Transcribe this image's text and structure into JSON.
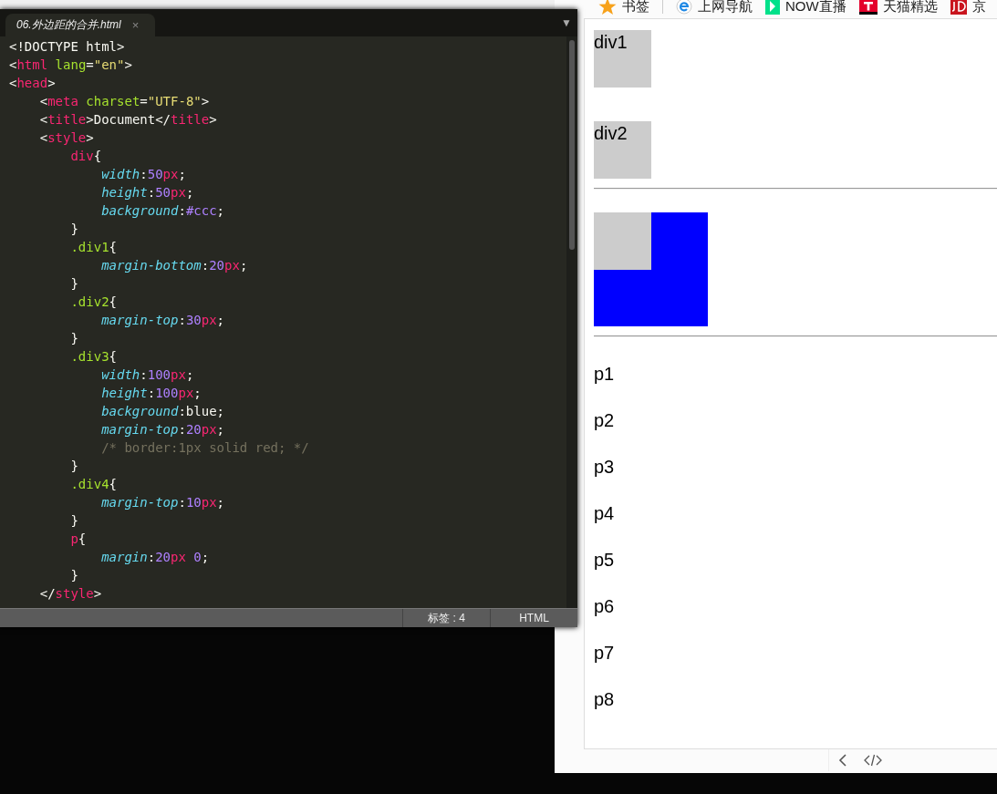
{
  "editor": {
    "tab": {
      "label": "06.外边距的合并.html",
      "close": "×",
      "selected": true
    },
    "menu_arrow": "▼",
    "lines": [
      [
        {
          "kind": "punct",
          "text": "<!DOCTYPE html>"
        }
      ],
      [
        {
          "kind": "punct",
          "text": "<"
        },
        {
          "kind": "tag",
          "text": "html "
        },
        {
          "kind": "attr",
          "text": "lang"
        },
        {
          "kind": "punct",
          "text": "="
        },
        {
          "kind": "string",
          "text": "\"en\""
        },
        {
          "kind": "punct",
          "text": ">"
        }
      ],
      [
        {
          "kind": "punct",
          "text": "<"
        },
        {
          "kind": "tag",
          "text": "head"
        },
        {
          "kind": "punct",
          "text": ">"
        }
      ],
      [
        {
          "kind": "punct",
          "text": "    <"
        },
        {
          "kind": "tag",
          "text": "meta "
        },
        {
          "kind": "attr",
          "text": "charset"
        },
        {
          "kind": "punct",
          "text": "="
        },
        {
          "kind": "string",
          "text": "\"UTF-8\""
        },
        {
          "kind": "punct",
          "text": ">"
        }
      ],
      [
        {
          "kind": "punct",
          "text": "    <"
        },
        {
          "kind": "tag",
          "text": "title"
        },
        {
          "kind": "punct",
          "text": ">Document</"
        },
        {
          "kind": "tag",
          "text": "title"
        },
        {
          "kind": "punct",
          "text": ">"
        }
      ],
      [
        {
          "kind": "punct",
          "text": "    <"
        },
        {
          "kind": "tag",
          "text": "style"
        },
        {
          "kind": "punct",
          "text": ">"
        }
      ],
      [
        {
          "kind": "tag",
          "text": "        div"
        },
        {
          "kind": "punct",
          "text": "{"
        }
      ],
      [
        {
          "kind": "prop",
          "text": "            width"
        },
        {
          "kind": "punct",
          "text": ":"
        },
        {
          "kind": "num",
          "text": "50"
        },
        {
          "kind": "unit",
          "text": "px"
        },
        {
          "kind": "punct",
          "text": ";"
        }
      ],
      [
        {
          "kind": "prop",
          "text": "            height"
        },
        {
          "kind": "punct",
          "text": ":"
        },
        {
          "kind": "num",
          "text": "50"
        },
        {
          "kind": "unit",
          "text": "px"
        },
        {
          "kind": "punct",
          "text": ";"
        }
      ],
      [
        {
          "kind": "prop",
          "text": "            background"
        },
        {
          "kind": "punct",
          "text": ":"
        },
        {
          "kind": "num",
          "text": "#ccc"
        },
        {
          "kind": "punct",
          "text": ";"
        }
      ],
      [
        {
          "kind": "punct",
          "text": "        }"
        }
      ],
      [
        {
          "kind": "attr",
          "text": "        .div1"
        },
        {
          "kind": "punct",
          "text": "{"
        }
      ],
      [
        {
          "kind": "prop",
          "text": "            margin-bottom"
        },
        {
          "kind": "punct",
          "text": ":"
        },
        {
          "kind": "num",
          "text": "20"
        },
        {
          "kind": "unit",
          "text": "px"
        },
        {
          "kind": "punct",
          "text": ";"
        }
      ],
      [
        {
          "kind": "punct",
          "text": "        }"
        }
      ],
      [
        {
          "kind": "attr",
          "text": "        .div2"
        },
        {
          "kind": "punct",
          "text": "{"
        }
      ],
      [
        {
          "kind": "prop",
          "text": "            margin-top"
        },
        {
          "kind": "punct",
          "text": ":"
        },
        {
          "kind": "num",
          "text": "30"
        },
        {
          "kind": "unit",
          "text": "px"
        },
        {
          "kind": "punct",
          "text": ";"
        }
      ],
      [
        {
          "kind": "punct",
          "text": "        }"
        }
      ],
      [
        {
          "kind": "attr",
          "text": "        .div3"
        },
        {
          "kind": "punct",
          "text": "{"
        }
      ],
      [
        {
          "kind": "prop",
          "text": "            width"
        },
        {
          "kind": "punct",
          "text": ":"
        },
        {
          "kind": "num",
          "text": "100"
        },
        {
          "kind": "unit",
          "text": "px"
        },
        {
          "kind": "punct",
          "text": ";"
        }
      ],
      [
        {
          "kind": "prop",
          "text": "            height"
        },
        {
          "kind": "punct",
          "text": ":"
        },
        {
          "kind": "num",
          "text": "100"
        },
        {
          "kind": "unit",
          "text": "px"
        },
        {
          "kind": "punct",
          "text": ";"
        }
      ],
      [
        {
          "kind": "prop",
          "text": "            background"
        },
        {
          "kind": "punct",
          "text": ":blue;"
        }
      ],
      [
        {
          "kind": "prop",
          "text": "            margin-top"
        },
        {
          "kind": "punct",
          "text": ":"
        },
        {
          "kind": "num",
          "text": "20"
        },
        {
          "kind": "unit",
          "text": "px"
        },
        {
          "kind": "punct",
          "text": ";"
        }
      ],
      [
        {
          "kind": "comment",
          "text": "            /* border:1px solid red; */"
        }
      ],
      [
        {
          "kind": "punct",
          "text": "        }"
        }
      ],
      [
        {
          "kind": "attr",
          "text": "        .div4"
        },
        {
          "kind": "punct",
          "text": "{"
        }
      ],
      [
        {
          "kind": "prop",
          "text": "            margin-top"
        },
        {
          "kind": "punct",
          "text": ":"
        },
        {
          "kind": "num",
          "text": "10"
        },
        {
          "kind": "unit",
          "text": "px"
        },
        {
          "kind": "punct",
          "text": ";"
        }
      ],
      [
        {
          "kind": "punct",
          "text": "        }"
        }
      ],
      [
        {
          "kind": "tag",
          "text": "        p"
        },
        {
          "kind": "punct",
          "text": "{"
        }
      ],
      [
        {
          "kind": "prop",
          "text": "            margin"
        },
        {
          "kind": "punct",
          "text": ":"
        },
        {
          "kind": "num",
          "text": "20"
        },
        {
          "kind": "unit",
          "text": "px "
        },
        {
          "kind": "num",
          "text": "0"
        },
        {
          "kind": "punct",
          "text": ";"
        }
      ],
      [
        {
          "kind": "punct",
          "text": "        }"
        }
      ],
      [
        {
          "kind": "punct",
          "text": "    </"
        },
        {
          "kind": "tag",
          "text": "style"
        },
        {
          "kind": "punct",
          "text": ">"
        }
      ]
    ],
    "status_bar": {
      "tab_size": "标签 : 4",
      "syntax": "HTML"
    }
  },
  "browser": {
    "bookmarks": [
      {
        "label": "书签",
        "kind": "star"
      },
      {
        "label": "上网导航",
        "kind": "ie"
      },
      {
        "label": "NOW直播",
        "kind": "now"
      },
      {
        "label": "天猫精选",
        "kind": "tmall"
      },
      {
        "label": "京",
        "kind": "jd"
      }
    ],
    "page": {
      "blocks": [
        {
          "kind": "box",
          "label": "div1"
        },
        {
          "kind": "box",
          "label": "div2"
        },
        {
          "kind": "rule"
        },
        {
          "kind": "nested"
        },
        {
          "kind": "rule"
        },
        {
          "kind": "para",
          "label": "p1"
        },
        {
          "kind": "para",
          "label": "p2"
        },
        {
          "kind": "para",
          "label": "p3"
        },
        {
          "kind": "para",
          "label": "p4"
        },
        {
          "kind": "para",
          "label": "p5"
        },
        {
          "kind": "para",
          "label": "p6"
        },
        {
          "kind": "para",
          "label": "p7"
        },
        {
          "kind": "para",
          "label": "p8"
        }
      ]
    }
  }
}
